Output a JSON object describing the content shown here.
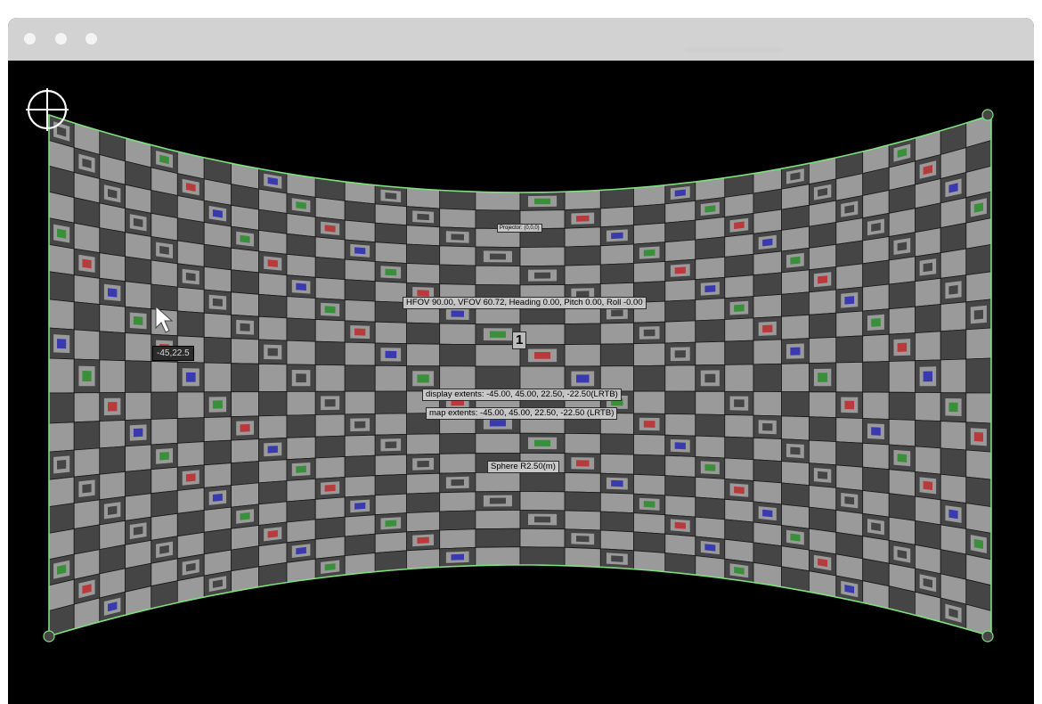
{
  "titlebar": {
    "dots": [
      "close",
      "minimize",
      "maximize"
    ]
  },
  "viewport": {
    "projector_label": "Projector: (0,0,0)",
    "fov_label": "HFOV 90.00, VFOV 60.72, Heading 0.00, Pitch 0.00, Roll -0.00",
    "projector_number": "1",
    "display_extents": "display extents: -45.00, 45.00, 22.50, -22.50(LRTB)",
    "map_extents": "map extents: -45.00, 45.00, 22.50, -22.50 (LRTB)",
    "sphere_label": "Sphere R2.50(m)",
    "cursor_tooltip": "-45,22.5"
  },
  "colors": {
    "background": "#000000",
    "outline": "#7ee07e",
    "tile_dark": "#454545",
    "tile_light": "#9a9a9a",
    "marker_red": "#b83a3a",
    "marker_green": "#3a8f3a",
    "marker_blue": "#3a3ab0"
  },
  "icons": {
    "corner_target": "crosshair-target-icon",
    "corner_handle": "corner-handle-icon",
    "cursor": "mouse-pointer-icon"
  }
}
